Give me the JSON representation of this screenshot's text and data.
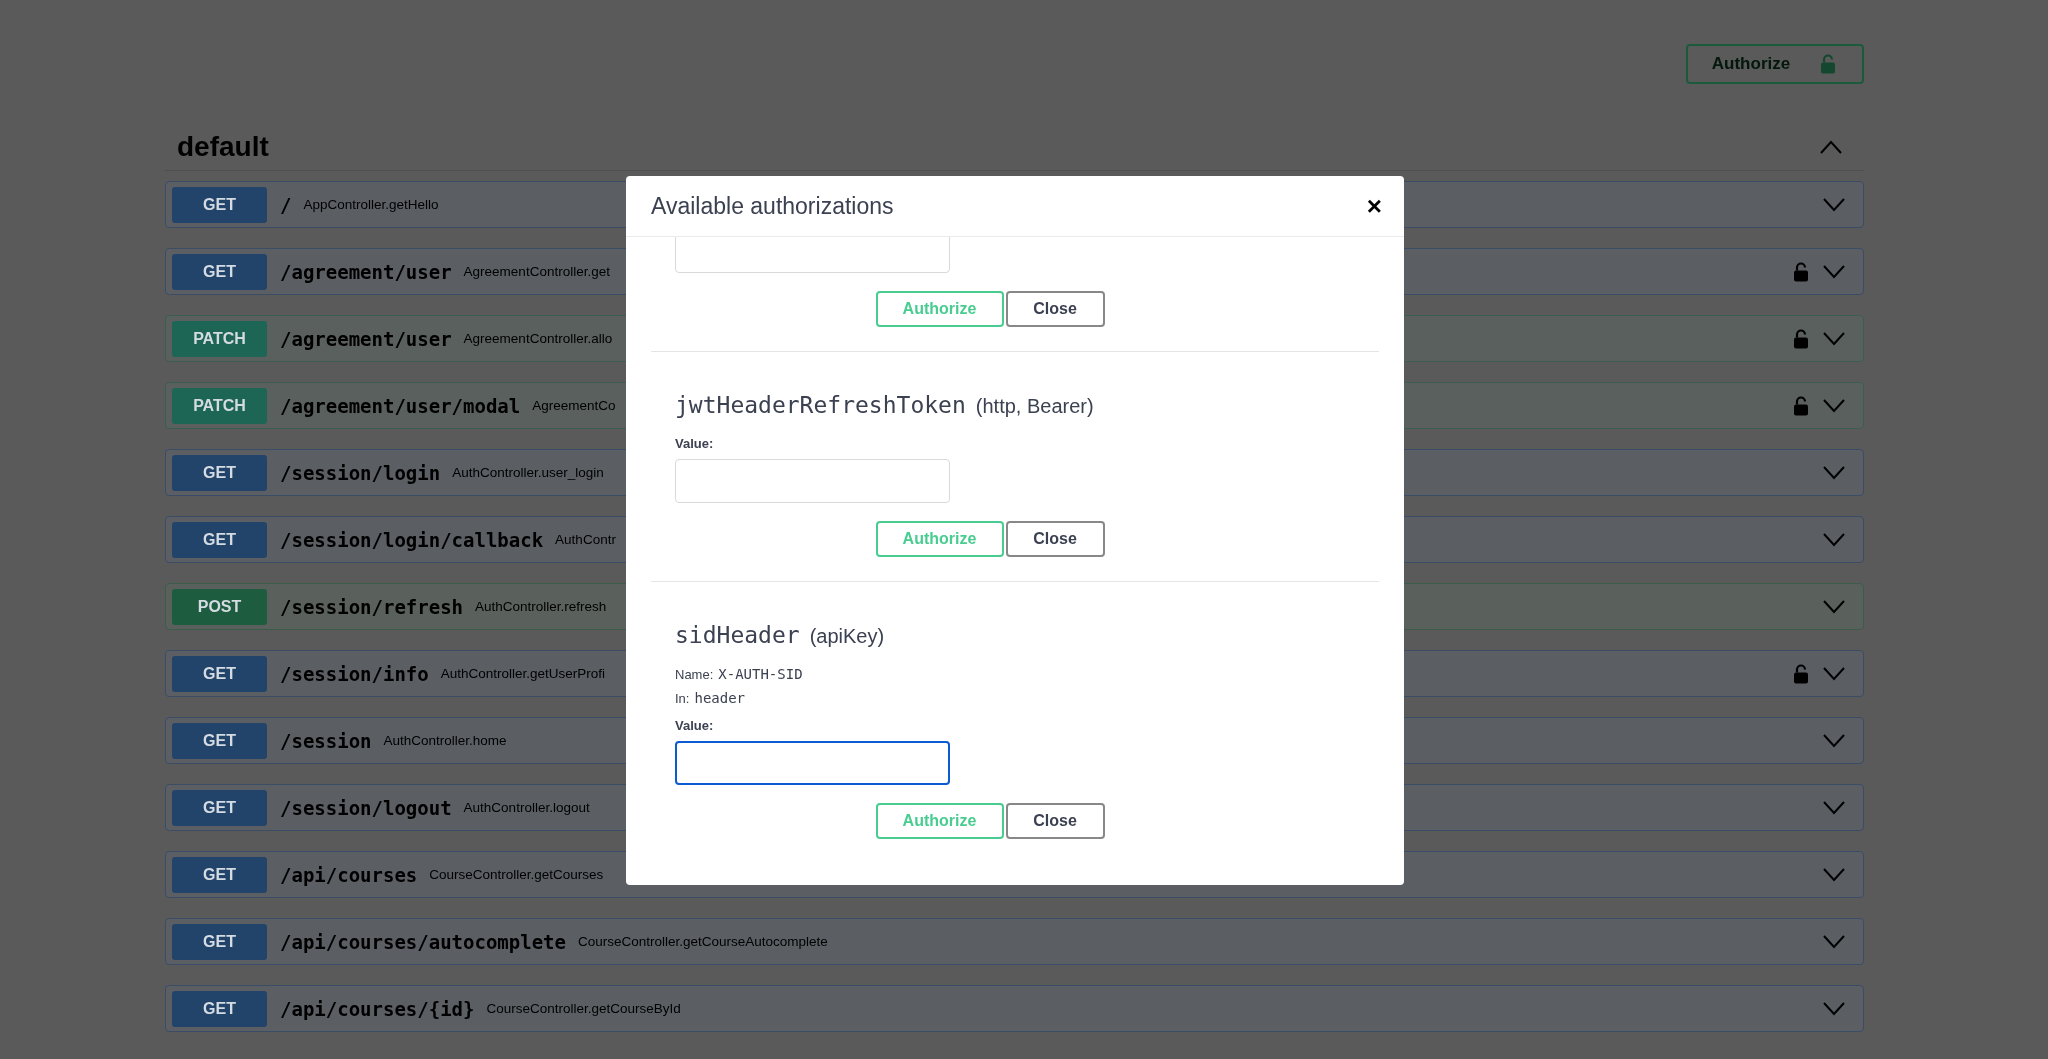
{
  "topbar": {
    "authorize_button": {
      "label": "Authorize"
    }
  },
  "section": {
    "title": "default",
    "expanded": true,
    "operations": [
      {
        "method": "GET",
        "kind": "get",
        "path": "/",
        "summary": "AppController.getHello",
        "locked": false
      },
      {
        "method": "GET",
        "kind": "get",
        "path": "/agreement/user",
        "summary": "AgreementController.get",
        "locked": true
      },
      {
        "method": "PATCH",
        "kind": "patch",
        "path": "/agreement/user",
        "summary": "AgreementController.allo",
        "locked": true
      },
      {
        "method": "PATCH",
        "kind": "patch",
        "path": "/agreement/user/modal",
        "summary": "AgreementCo",
        "locked": true
      },
      {
        "method": "GET",
        "kind": "get",
        "path": "/session/login",
        "summary": "AuthController.user_login",
        "locked": false
      },
      {
        "method": "GET",
        "kind": "get",
        "path": "/session/login/callback",
        "summary": "AuthContr",
        "locked": false
      },
      {
        "method": "POST",
        "kind": "post",
        "path": "/session/refresh",
        "summary": "AuthController.refresh",
        "locked": false
      },
      {
        "method": "GET",
        "kind": "get",
        "path": "/session/info",
        "summary": "AuthController.getUserProfi",
        "locked": true
      },
      {
        "method": "GET",
        "kind": "get",
        "path": "/session",
        "summary": "AuthController.home",
        "locked": false
      },
      {
        "method": "GET",
        "kind": "get",
        "path": "/session/logout",
        "summary": "AuthController.logout",
        "locked": false
      },
      {
        "method": "GET",
        "kind": "get",
        "path": "/api/courses",
        "summary": "CourseController.getCourses",
        "locked": false
      },
      {
        "method": "GET",
        "kind": "get",
        "path": "/api/courses/autocomplete",
        "summary": "CourseController.getCourseAutocomplete",
        "locked": false
      },
      {
        "method": "GET",
        "kind": "get",
        "path": "/api/courses/{id}",
        "summary": "CourseController.getCourseById",
        "locked": false
      }
    ]
  },
  "auth_dialog": {
    "title": "Available authorizations",
    "close": "×",
    "schemes": [
      {
        "kind": "partial",
        "field": {
          "focused": false
        },
        "buttons": [
          "Authorize",
          "Close"
        ]
      },
      {
        "kind": "full",
        "name": "jwtHeaderRefreshToken",
        "type": "(http, Bearer)",
        "value_label": "Value:",
        "field": {
          "focused": false
        },
        "buttons": [
          "Authorize",
          "Close"
        ]
      },
      {
        "kind": "full",
        "name": "sidHeader",
        "type": "(apiKey)",
        "details": [
          {
            "label": "Name:",
            "value": "X-AUTH-SID"
          },
          {
            "label": "In:",
            "value": "header"
          }
        ],
        "value_label": "Value:",
        "field": {
          "focused": true
        },
        "buttons": [
          "Authorize",
          "Close"
        ]
      }
    ]
  }
}
